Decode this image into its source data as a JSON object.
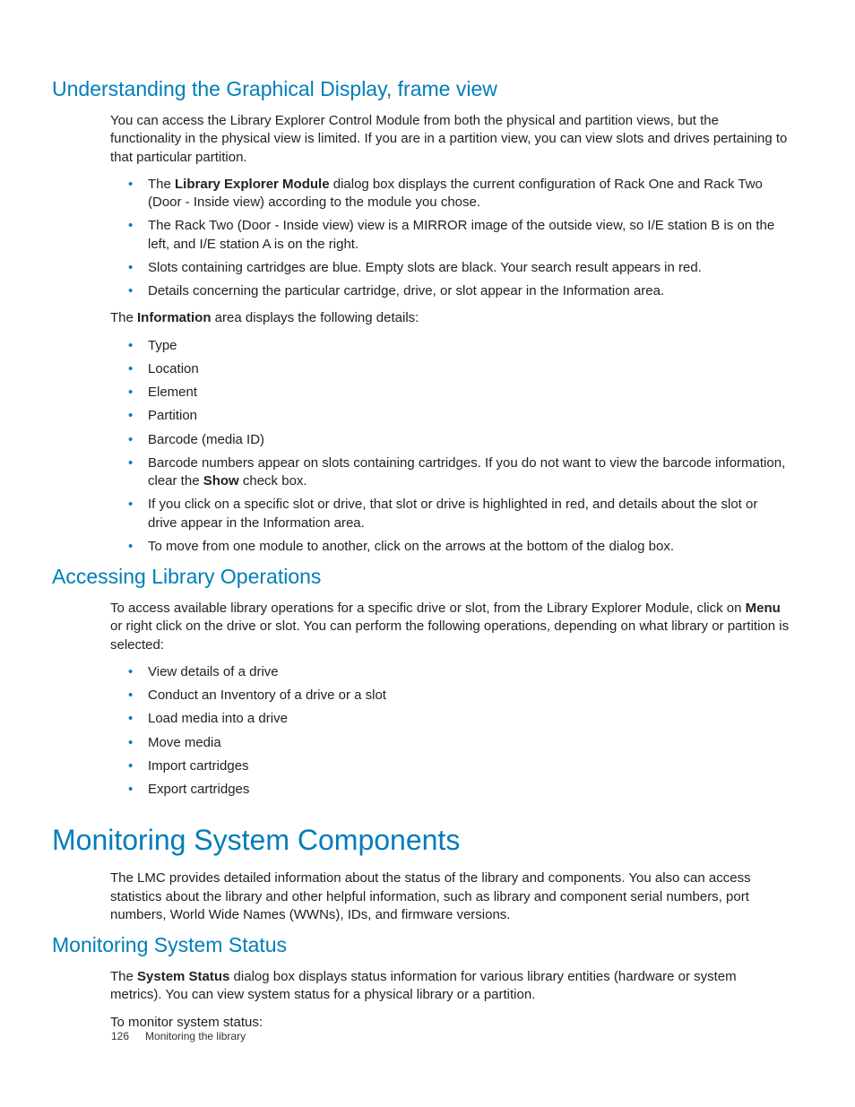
{
  "sections": {
    "s1": {
      "title": "Understanding the Graphical Display, frame view",
      "intro": "You can access the Library Explorer Control Module from both the physical and partition views, but the functionality in the physical view is limited. If you are in a partition view, you can view slots and drives pertaining to that particular partition.",
      "bullets_a": {
        "b0_pre": "The ",
        "b0_bold": "Library Explorer Module",
        "b0_post": " dialog box displays the current configuration of Rack One and Rack Two (Door - Inside view) according to the module you chose.",
        "b1": "The Rack Two (Door - Inside view) view is a MIRROR image of the outside view, so I/E station B is on the left, and I/E station A is on the right.",
        "b2": "Slots containing cartridges are blue. Empty slots are black. Your search result appears in red.",
        "b3": "Details concerning the particular cartridge, drive, or slot appear in the Information area."
      },
      "mid_pre": "The ",
      "mid_bold": "Information",
      "mid_post": " area displays the following details:",
      "bullets_b": {
        "b0": "Type",
        "b1": "Location",
        "b2": "Element",
        "b3": "Partition",
        "b4": "Barcode (media ID)",
        "b5_pre": "Barcode numbers appear on slots containing cartridges. If you do not want to view the barcode information, clear the ",
        "b5_bold": "Show",
        "b5_post": " check box.",
        "b6": "If you click on a specific slot or drive, that slot or drive is highlighted in red, and details about the slot or drive appear in the Information area.",
        "b7": "To move from one module to another, click on the arrows at the bottom of the dialog box."
      }
    },
    "s2": {
      "title": "Accessing Library Operations",
      "intro_pre": "To access available library operations for a specific drive or slot, from the Library Explorer Module, click on ",
      "intro_bold": "Menu",
      "intro_post": " or right click on the drive or slot. You can perform the following operations, depending on what library or partition is selected:",
      "bullets": {
        "b0": "View details of a drive",
        "b1": "Conduct an Inventory of a drive or a slot",
        "b2": "Load media into a drive",
        "b3": "Move media",
        "b4": "Import cartridges",
        "b5": "Export cartridges"
      }
    },
    "s3": {
      "title": "Monitoring System Components",
      "intro": "The LMC provides detailed information about the status of the library and components. You also can access statistics about the library and other helpful information, such as library and component serial numbers, port numbers, World Wide Names (WWNs), IDs, and firmware versions."
    },
    "s4": {
      "title": "Monitoring System Status",
      "p1_pre": "The ",
      "p1_bold": "System Status",
      "p1_post": " dialog box displays status information for various library entities (hardware or system metrics). You can view system status for a physical library or a partition.",
      "p2": "To monitor system status:"
    }
  },
  "footer": {
    "page": "126",
    "chapter": "Monitoring the library"
  }
}
